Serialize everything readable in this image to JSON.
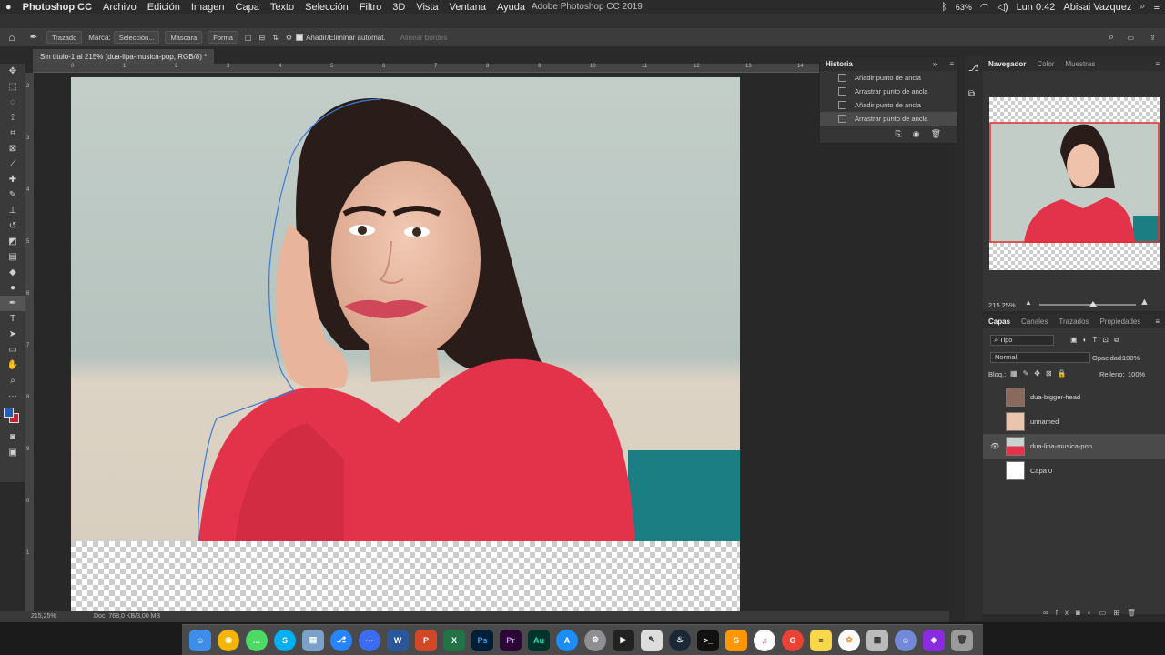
{
  "menubar": {
    "apple": "",
    "app": "Photoshop CC",
    "items": [
      "Archivo",
      "Edición",
      "Imagen",
      "Capa",
      "Texto",
      "Selección",
      "Filtro",
      "3D",
      "Vista",
      "Ventana",
      "Ayuda"
    ],
    "window_title": "Adobe Photoshop CC 2019",
    "battery": "63%",
    "clock": "Lun 0:42",
    "user": "Abisai Vazquez"
  },
  "options_bar": {
    "mode": "Trazado",
    "marca_label": "Marca:",
    "seleccion": "Selección...",
    "mascara": "Máscara",
    "forma": "Forma",
    "auto_add": "Añadir/Eliminar automát.",
    "align_edges": "Alinear bordes"
  },
  "document": {
    "tab_title": "Sin título-1 al 215% (dua-lipa-musica-pop, RGB/8) *",
    "zoom": "215,25%",
    "doc_size": "Doc: 768,0 KB/3,00 MB",
    "ruler_top": [
      "0",
      "1",
      "2",
      "3",
      "4",
      "5",
      "6",
      "7",
      "8",
      "9",
      "10",
      "11",
      "12",
      "13",
      "14"
    ],
    "ruler_left": [
      "2",
      "3",
      "4",
      "5",
      "6",
      "7",
      "8",
      "9",
      "0",
      "1"
    ]
  },
  "history": {
    "tabs": [
      "Historia"
    ],
    "items": [
      "Añadir punto de ancla",
      "Arrastrar punto de ancla",
      "Añadir punto de ancla",
      "Arrastrar punto de ancla"
    ],
    "selected_index": 3
  },
  "navigator": {
    "tabs": [
      "Navegador",
      "Color",
      "Muestras"
    ],
    "zoom": "215.25%"
  },
  "layers": {
    "tabs": [
      "Capas",
      "Canales",
      "Trazados",
      "Propiedades"
    ],
    "filter": "Tipo",
    "blend_mode": "Normal",
    "opacity_label": "Opacidad:",
    "opacity": "100%",
    "lock_label": "Bloq.:",
    "fill_label": "Relleno:",
    "fill": "100%",
    "items": [
      {
        "name": "dua-bigger-head",
        "visible": false,
        "selected": false
      },
      {
        "name": "unnamed",
        "visible": false,
        "selected": false
      },
      {
        "name": "dua-lipa-musica-pop",
        "visible": true,
        "selected": true
      },
      {
        "name": "Capa 0",
        "visible": false,
        "selected": false
      }
    ]
  },
  "colors": {
    "foreground": "#1f5fb5",
    "background": "#d01f2f",
    "shirt": "#e2334a",
    "wall": "#b8c5c0",
    "teal": "#1b7e82"
  },
  "dock_icons": [
    "finder-icon",
    "chrome-icon",
    "messages-icon",
    "skype-icon",
    "preview-icon",
    "sourcetree-icon",
    "dots-icon",
    "word-icon",
    "powerpoint-icon",
    "excel-icon",
    "photoshop-icon",
    "premiere-icon",
    "audition-icon",
    "appstore-icon",
    "settings-icon",
    "finalcut-icon",
    "scripteditor-icon",
    "steam-icon",
    "terminal-icon",
    "sublime-icon",
    "itunes-icon",
    "google-icon",
    "notes-icon",
    "photos-icon",
    "calculator-icon",
    "discord-icon",
    "game-icon",
    "trash-icon"
  ]
}
